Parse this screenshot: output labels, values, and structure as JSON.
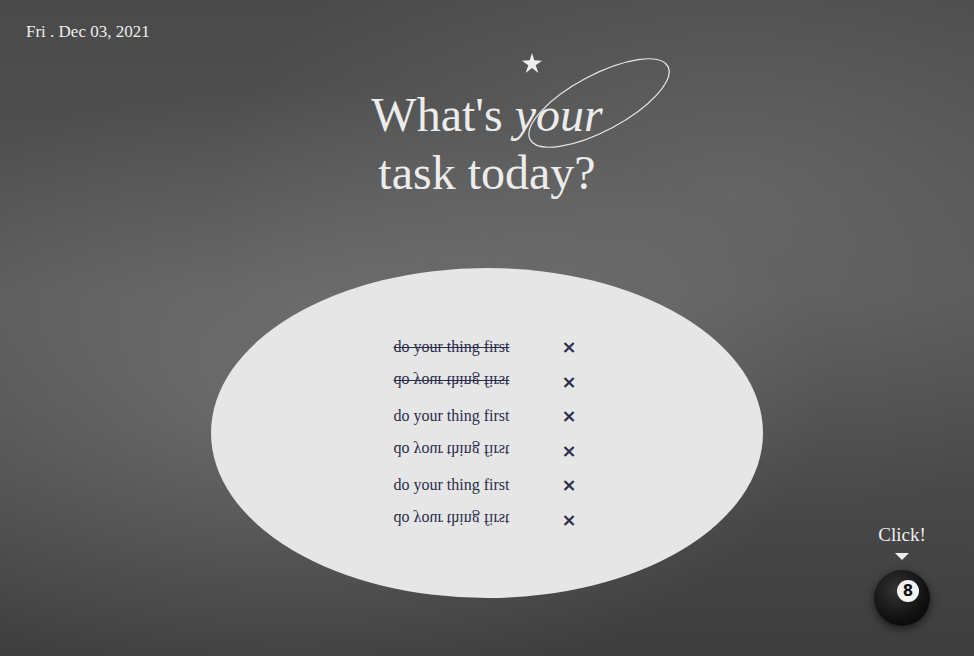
{
  "header": {
    "date": "Fri . Dec 03, 2021"
  },
  "title": {
    "before": "What's",
    "highlight": "your",
    "line2": "task today?"
  },
  "tasks": [
    {
      "text": "do your thing first",
      "done": true,
      "flipped": false,
      "remove": "×"
    },
    {
      "text": "do your thing first",
      "done": true,
      "flipped": true,
      "remove": "×"
    },
    {
      "text": "do your thing first",
      "done": false,
      "flipped": false,
      "remove": "×"
    },
    {
      "text": "do your thing first",
      "done": false,
      "flipped": true,
      "remove": "×"
    },
    {
      "text": "do your thing first",
      "done": false,
      "flipped": false,
      "remove": "×"
    },
    {
      "text": "do your thing first",
      "done": false,
      "flipped": true,
      "remove": "×"
    }
  ],
  "action": {
    "hint": "Click!",
    "ball": "8"
  }
}
